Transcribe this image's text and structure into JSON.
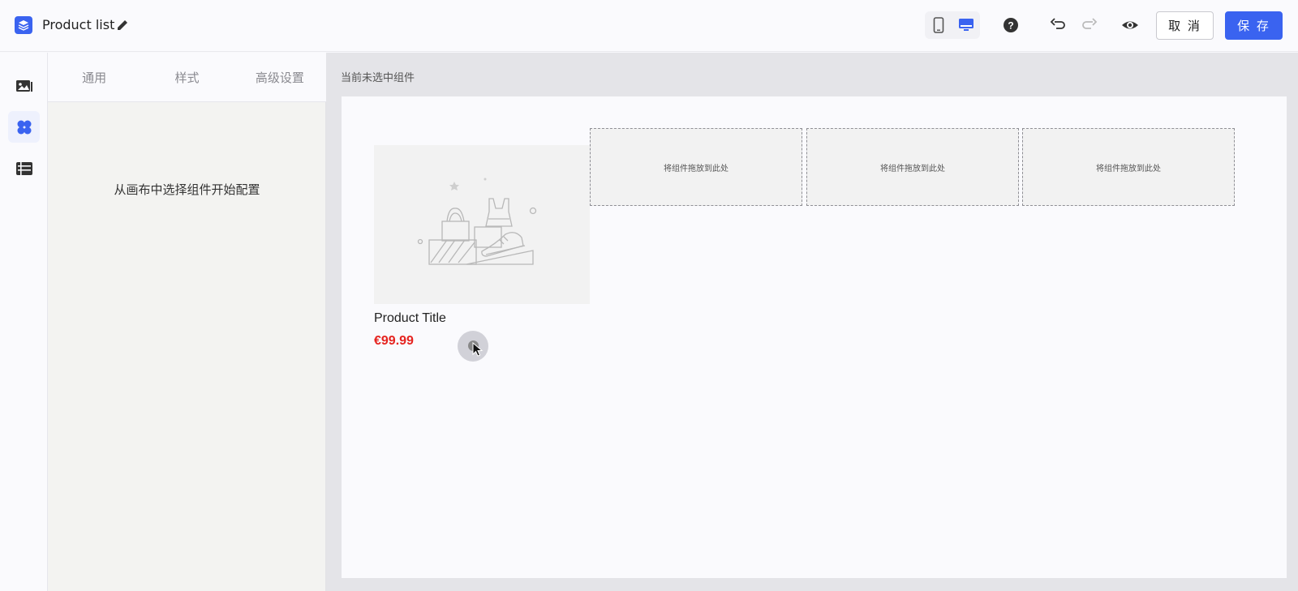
{
  "header": {
    "title": "Product list",
    "cancel_label": "取 消",
    "save_label": "保 存"
  },
  "config_panel": {
    "tabs": [
      "通用",
      "样式",
      "高级设置"
    ],
    "empty_hint": "从画布中选择组件开始配置"
  },
  "canvas": {
    "status": "当前未选中组件",
    "product": {
      "title": "Product Title",
      "price": "€99.99"
    },
    "dropzones": [
      "将组件拖放到此处",
      "将组件拖放到此处",
      "将组件拖放到此处"
    ]
  },
  "icons": {
    "rail": [
      "media-icon",
      "components-icon",
      "layers-icon"
    ],
    "toolbar": [
      "mobile-icon",
      "desktop-icon",
      "help-icon",
      "undo-icon",
      "redo-icon",
      "preview-icon"
    ]
  },
  "colors": {
    "primary": "#3a63f0",
    "price": "#e5231f"
  }
}
